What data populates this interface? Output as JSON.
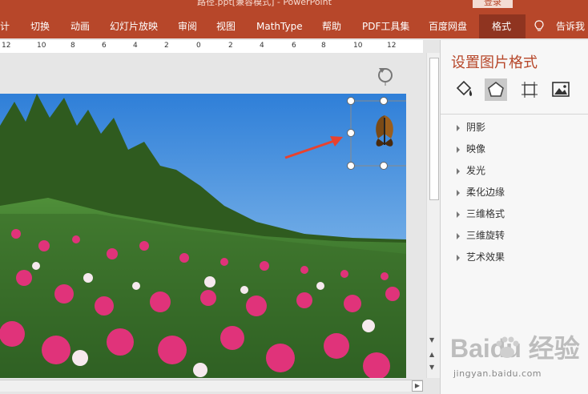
{
  "window": {
    "title": "路径.ppt[兼容模式] - PowerPoint",
    "login_label": "登录"
  },
  "ribbon": {
    "tabs": [
      {
        "label": "计"
      },
      {
        "label": "切换"
      },
      {
        "label": "动画"
      },
      {
        "label": "幻灯片放映"
      },
      {
        "label": "审阅"
      },
      {
        "label": "视图"
      },
      {
        "label": "MathType"
      },
      {
        "label": "帮助"
      },
      {
        "label": "PDF工具集"
      },
      {
        "label": "百度网盘"
      },
      {
        "label": "格式"
      }
    ],
    "active_tab": "格式",
    "tell_me": "告诉我"
  },
  "ruler": {
    "ticks": [
      "12",
      "10",
      "8",
      "6",
      "4",
      "2",
      "0",
      "2",
      "4",
      "6",
      "8",
      "10",
      "12"
    ]
  },
  "format_pane": {
    "title": "设置图片格式",
    "icons": [
      "fill-line-icon",
      "effects-icon",
      "size-properties-icon",
      "picture-icon"
    ],
    "selected_icon": "effects-icon",
    "sections": [
      {
        "label": "阴影"
      },
      {
        "label": "映像"
      },
      {
        "label": "发光"
      },
      {
        "label": "柔化边缘"
      },
      {
        "label": "三维格式"
      },
      {
        "label": "三维旋转"
      },
      {
        "label": "艺术效果"
      }
    ]
  },
  "watermark": {
    "brand": "Baidu 经验",
    "url": "jingyan.baidu.com"
  },
  "colors": {
    "accent": "#b7472a",
    "pane_title": "#b7472a",
    "arrow": "#e8422e"
  }
}
